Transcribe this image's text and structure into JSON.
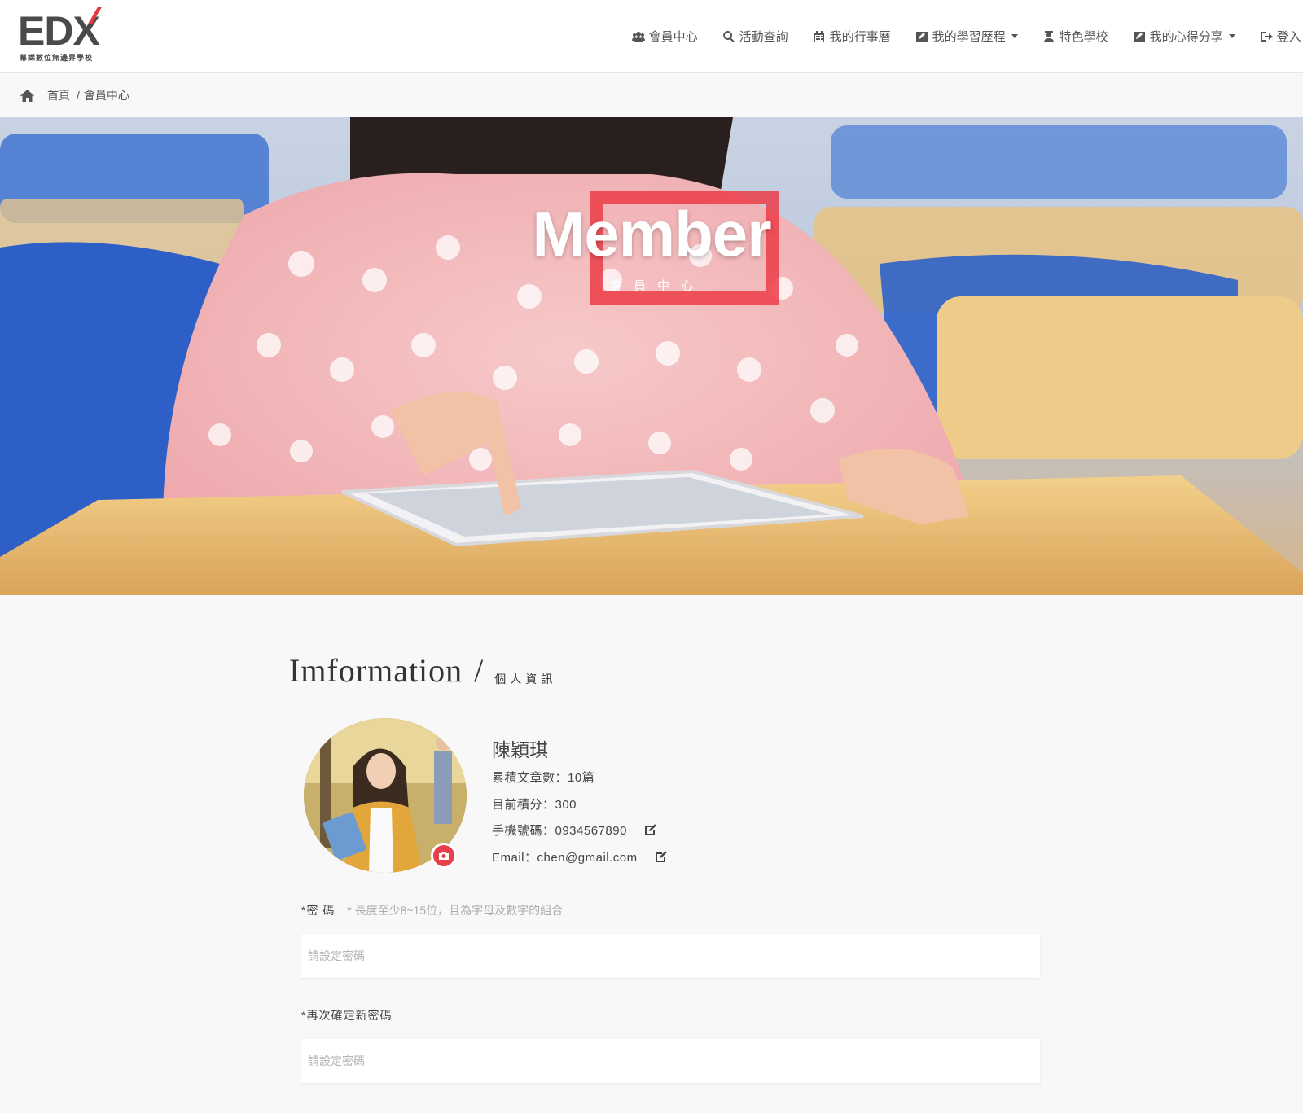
{
  "logo": {
    "text": "EDX",
    "subtitle": "幕課數位無邊界學校"
  },
  "nav": {
    "items": [
      {
        "label": "會員中心",
        "icon": "users-icon"
      },
      {
        "label": "活動查詢",
        "icon": "search-icon"
      },
      {
        "label": "我的行事曆",
        "icon": "calendar-icon"
      },
      {
        "label": "我的學習歷程",
        "icon": "edit-square-icon",
        "dropdown": true
      },
      {
        "label": "特色學校",
        "icon": "graduate-icon"
      },
      {
        "label": "我的心得分享",
        "icon": "edit-square-icon",
        "dropdown": true
      },
      {
        "label": "登入 /",
        "icon": "sign-in-icon"
      }
    ]
  },
  "breadcrumb": {
    "home": "首頁",
    "separator": "/",
    "current": "會員中心"
  },
  "hero": {
    "title": "Member",
    "subtitle": "會員中心"
  },
  "info": {
    "title": "Imformation",
    "slash": "/",
    "subtitle": "個人資訊"
  },
  "profile": {
    "name": "陳穎琪",
    "articles": "累積文章數：10篇",
    "points": "目前積分：300",
    "phone": "手機號碼：0934567890",
    "email": "Email：chen@gmail.com"
  },
  "form": {
    "password_label": "*密 碼",
    "password_hint": "* 長度至少8~15位，且為字母及數字的組合",
    "password_placeholder": "請設定密碼",
    "confirm_label": "*再次確定新密碼",
    "confirm_placeholder": "請設定密碼"
  },
  "colors": {
    "accent": "#e8404a",
    "text": "#444444",
    "background": "#f8f8f8"
  }
}
